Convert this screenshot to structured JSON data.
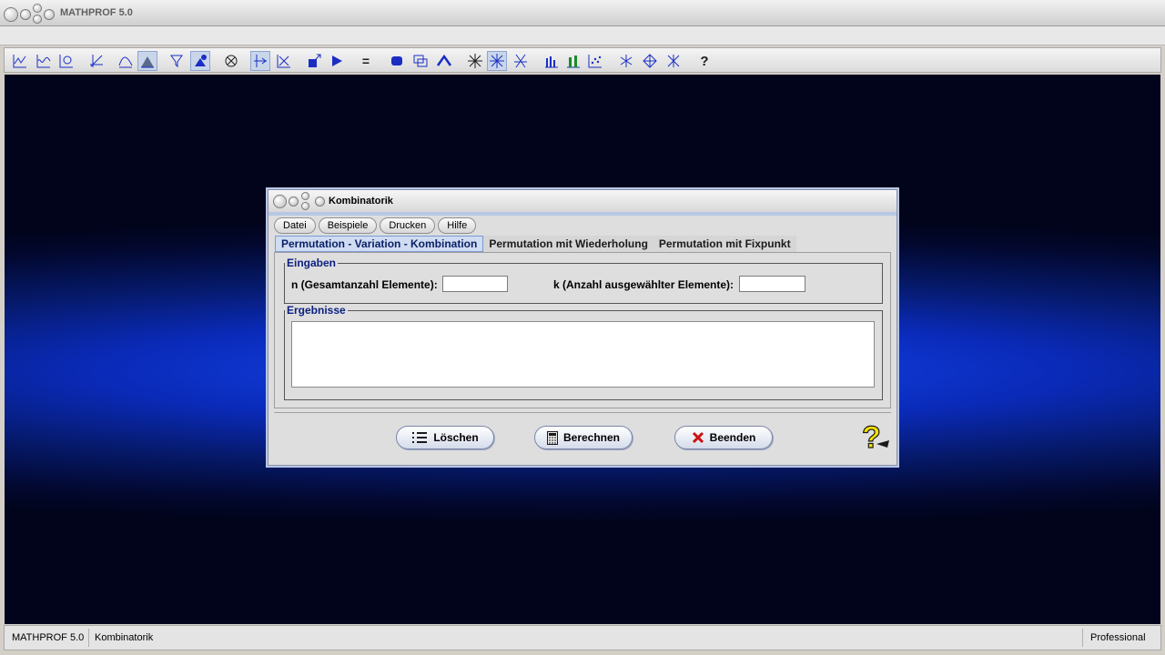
{
  "app": {
    "title": "MATHPROF 5.0"
  },
  "toolbar": {
    "icons": [
      "plot-curve-icon",
      "plot-multi-icon",
      "plot-param-icon",
      "plot-axes-icon",
      "plot-peak-icon",
      "plot-area-icon",
      "funnel-icon",
      "tool-active-icon",
      "cross-circle-icon",
      "arrow-axes-icon",
      "star-axes-icon",
      "export-icon",
      "play-icon",
      "equals-icon",
      "block-icon",
      "layers-icon",
      "house-icon",
      "spark-icon",
      "grid-star-icon",
      "tilt-star-icon",
      "bars-icon",
      "bars-green-icon",
      "scatter-icon",
      "asterisk-icon",
      "diamond-icon",
      "sparkle-icon",
      "question-icon"
    ],
    "equals_label": "=",
    "help_label": "?"
  },
  "statusbar": {
    "app": "MATHPROF 5.0",
    "module": "Kombinatorik",
    "edition": "Professional"
  },
  "dialog": {
    "title": "Kombinatorik",
    "menu": [
      "Datei",
      "Beispiele",
      "Drucken",
      "Hilfe"
    ],
    "tabs": [
      "Permutation - Variation - Kombination",
      "Permutation mit Wiederholung",
      "Permutation mit Fixpunkt"
    ],
    "active_tab": 0,
    "inputs_group": "Eingaben",
    "n_label": "n (Gesamtanzahl Elemente):",
    "n_value": "",
    "k_label": "k (Anzahl ausgewählter Elemente):",
    "k_value": "",
    "results_group": "Ergebnisse",
    "results_text": "",
    "buttons": {
      "clear": "Löschen",
      "calculate": "Berechnen",
      "exit": "Beenden"
    }
  },
  "colors": {
    "accent": "#0a1f80",
    "desktop": "#0a2ab8",
    "exit_icon": "#cc1111",
    "help_icon": "#f2e200"
  }
}
